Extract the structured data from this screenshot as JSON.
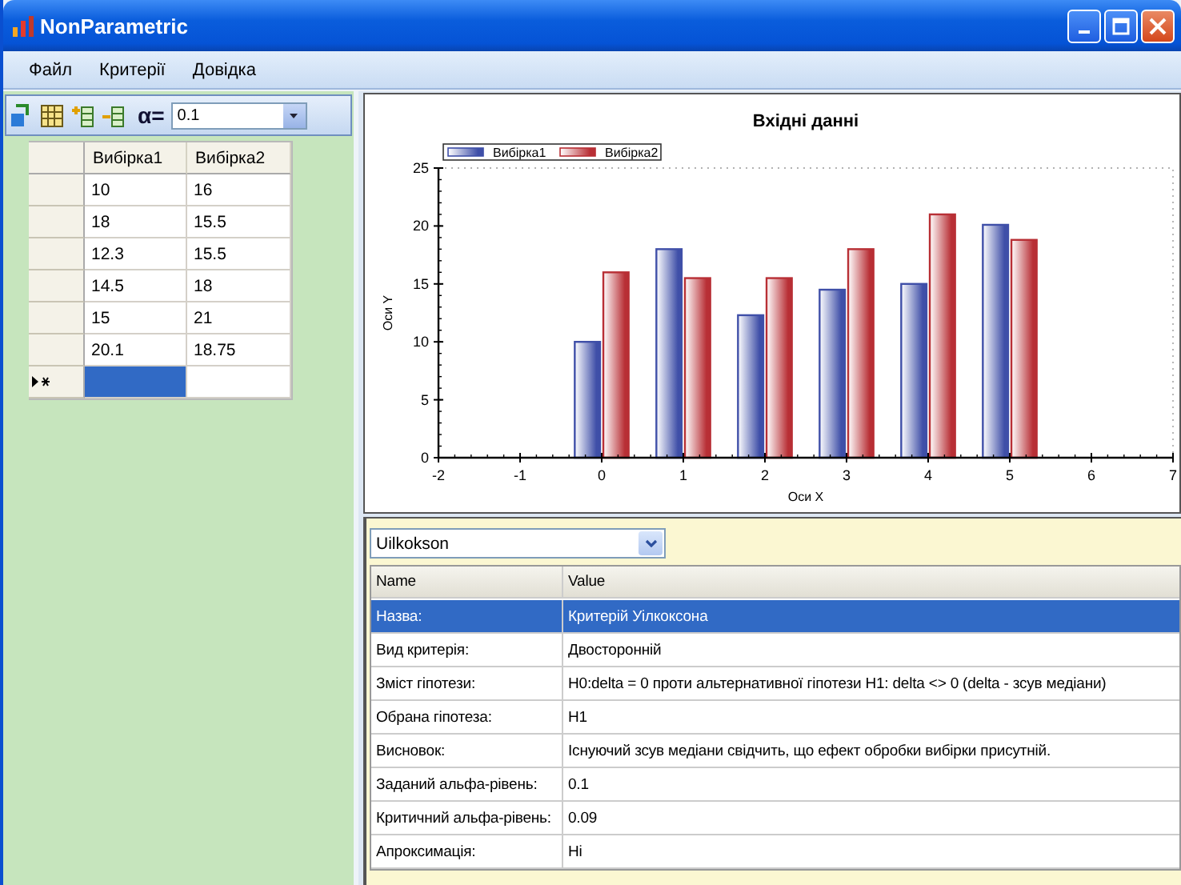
{
  "window": {
    "title": "NonParametric"
  },
  "menu": [
    {
      "label": "Файл"
    },
    {
      "label": "Критерії"
    },
    {
      "label": "Довідка"
    }
  ],
  "toolbar": {
    "alpha_label": "α=",
    "alpha_value": "0.1"
  },
  "data_grid": {
    "columns": [
      "Вибірка1",
      "Вибірка2"
    ],
    "rows": [
      {
        "cells": [
          "10",
          "16"
        ]
      },
      {
        "cells": [
          "18",
          "15.5"
        ]
      },
      {
        "cells": [
          "12.3",
          "15.5"
        ]
      },
      {
        "cells": [
          "14.5",
          "18"
        ]
      },
      {
        "cells": [
          "15",
          "21"
        ]
      },
      {
        "cells": [
          "20.1",
          "18.75"
        ]
      }
    ],
    "new_row": {
      "cells": [
        {
          "selected": true
        },
        {
          "selected": false
        }
      ]
    }
  },
  "chart": {
    "chart_data": {
      "type": "bar",
      "title": "Вхідні данні",
      "xlabel": "Оси X",
      "ylabel": "Оси Y",
      "x": [
        0,
        1,
        2,
        3,
        4,
        5
      ],
      "series": [
        {
          "name": "Вибірка1",
          "color": "#3f4fa8",
          "values": [
            10,
            18,
            12.3,
            14.5,
            15,
            20.1
          ]
        },
        {
          "name": "Вибірка2",
          "color": "#b82f35",
          "values": [
            16,
            15.5,
            15.5,
            18,
            21,
            18.8
          ]
        }
      ],
      "legend": "top-left",
      "xlim": [
        -2,
        7
      ],
      "ylim": [
        0,
        25
      ],
      "xticks": [
        -2,
        -1,
        0,
        1,
        2,
        3,
        4,
        5,
        6,
        7
      ],
      "yticks": [
        0,
        5,
        10,
        15,
        20,
        25
      ]
    }
  },
  "results": {
    "method": "Uilkokson",
    "columns": [
      "Name",
      "Value"
    ],
    "rows": [
      {
        "name": "Назва:",
        "value": "Критерій Уілкоксона",
        "selected": true
      },
      {
        "name": "Вид критерія:",
        "value": "Двосторонній",
        "selected": false
      },
      {
        "name": "Зміст гіпотези:",
        "value": "H0:delta = 0 проти альтернативної гіпотези H1: delta <>  0 (delta - зсув медіани)",
        "selected": false
      },
      {
        "name": "Обрана гіпотеза:",
        "value": "H1",
        "selected": false
      },
      {
        "name": "Висновок:",
        "value": "Існуючий зсув медіани свідчить, що ефект обробки вибірки присутній.",
        "selected": false
      },
      {
        "name": "Заданий альфа-рівень:",
        "value": "0.1",
        "selected": false
      },
      {
        "name": "Критичний альфа-рівень:",
        "value": "0.09",
        "selected": false
      },
      {
        "name": "Апроксимація:",
        "value": "Ні",
        "selected": false
      }
    ]
  }
}
